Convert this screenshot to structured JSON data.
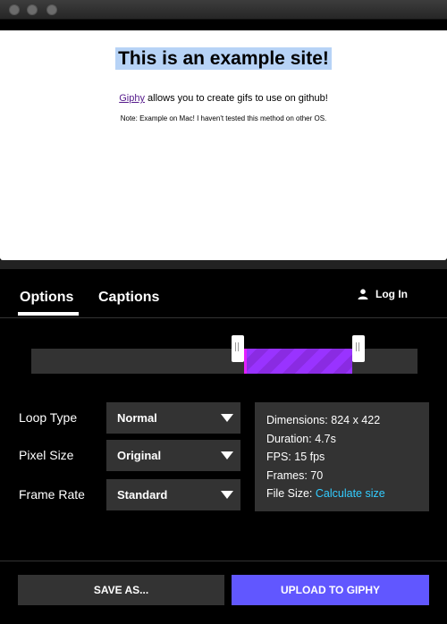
{
  "capture": {
    "title": "This is an example site!",
    "line_link": "Giphy",
    "line_rest": " allows you to create gifs to use on github!",
    "note": "Note: Example on Mac! I haven't tested this method on other OS."
  },
  "tabs": [
    {
      "label": "Options",
      "active": true
    },
    {
      "label": "Captions",
      "active": false
    }
  ],
  "login_label": "Log In",
  "trim": {
    "start_fraction": 0.55,
    "end_fraction": 0.83
  },
  "options": {
    "loop_type": {
      "label": "Loop Type",
      "value": "Normal"
    },
    "pixel_size": {
      "label": "Pixel Size",
      "value": "Original"
    },
    "frame_rate": {
      "label": "Frame Rate",
      "value": "Standard"
    }
  },
  "info": {
    "dimensions": "Dimensions: 824 x 422",
    "duration": "Duration: 4.7s",
    "fps": "FPS: 15 fps",
    "frames": "Frames: 70",
    "file_size_label": "File Size: ",
    "file_size_link": "Calculate size"
  },
  "buttons": {
    "save": "SAVE AS...",
    "upload": "UPLOAD TO GIPHY"
  },
  "colors": {
    "accent": "#6157ff",
    "selection": "#9933ff",
    "link": "#33ccff"
  }
}
